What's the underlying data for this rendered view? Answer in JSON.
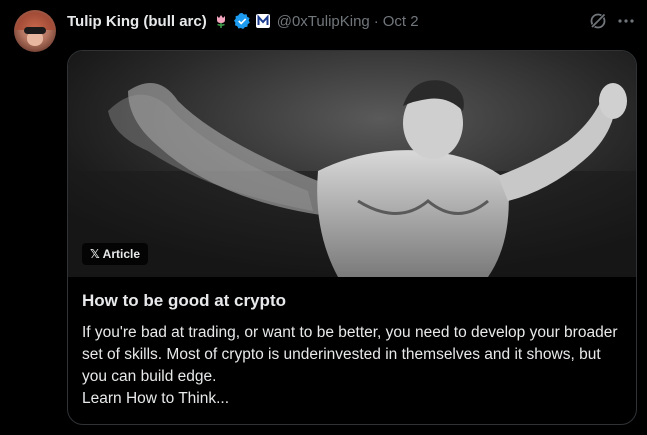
{
  "author": {
    "display_name": "Tulip King (bull arc)",
    "handle": "@0xTulipKing",
    "separator": "·",
    "date": "Oct 2",
    "emoji_icon": "tulip-icon",
    "verified_color": "#1d9bf0"
  },
  "article": {
    "badge_mark": "𝕏",
    "badge_label": "Article",
    "title": "How to be good at crypto",
    "body_line_1": "If you're bad at trading, or want to be better, you need to develop your broader set of skills. Most of crypto is underinvested in themselves and it shows, but you can build edge.",
    "body_line_2": "Learn How to Think..."
  },
  "colors": {
    "text_primary": "#e7e9ea",
    "text_secondary": "#71767b",
    "border": "#2f3336",
    "background": "#000000"
  }
}
